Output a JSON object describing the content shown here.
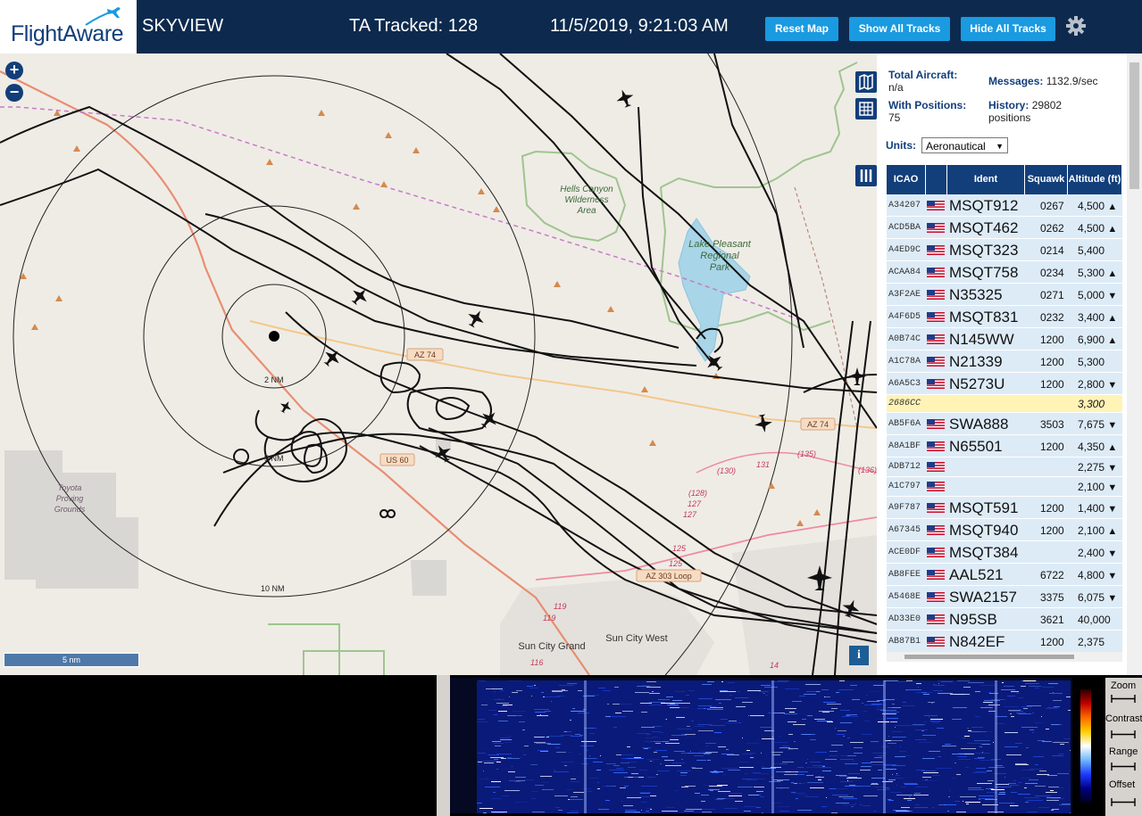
{
  "header": {
    "logo_text": "FlightAware",
    "site_name": "SKYVIEW",
    "tracked": "TA Tracked: 128",
    "datetime": "11/5/2019, 9:21:03 AM",
    "reset_map": "Reset Map",
    "show_tracks": "Show All Tracks",
    "hide_tracks": "Hide All Tracks",
    "settings_icon": "gear-icon"
  },
  "map": {
    "labels": {
      "hells_canyon": [
        "Hells Canyon",
        "Wilderness",
        "Area"
      ],
      "lake_pleasant": [
        "Lake Pleasant",
        "Regional",
        "Park"
      ],
      "toyota": [
        "Toyota",
        "Proving",
        "Grounds"
      ],
      "sun_city_grand": "Sun City Grand",
      "sun_city_west": "Sun City West",
      "az74_a": "AZ 74",
      "az74_b": "AZ 74",
      "us60": "US 60",
      "az303": "AZ 303 Loop",
      "ring_2": "2 NM",
      "ring_5": "5 NM",
      "ring_10": "10 NM",
      "r130": "(130)",
      "r135": "(135)",
      "r136": "(136)",
      "r131": "131",
      "r128": "(128)",
      "r127a": "127",
      "r127b": "127",
      "r125a": "125",
      "r125b": "125",
      "r119a": "119",
      "r119b": "119",
      "r116": "116",
      "r14": "14"
    },
    "scale": "5 nm",
    "zoom_in": "+",
    "zoom_out": "−",
    "info": "i"
  },
  "stats": {
    "total_label": "Total Aircraft:",
    "total_value": "n/a",
    "messages_label": "Messages:",
    "messages_value": "1132.9/sec",
    "positions_label": "With Positions:",
    "positions_value": "75",
    "history_label": "History:",
    "history_value": "29802",
    "history_unit": "positions",
    "units_label": "Units:",
    "units_value": "Aeronautical"
  },
  "table": {
    "headers": [
      "ICAO",
      "",
      "Ident",
      "Squawk",
      "Altitude (ft)"
    ],
    "rows": [
      {
        "icao": "A34207",
        "ident": "MSQT912",
        "squawk": "0267",
        "alt": "4,500",
        "trend": "▲"
      },
      {
        "icao": "ACD5BA",
        "ident": "MSQT462",
        "squawk": "0262",
        "alt": "4,500",
        "trend": "▲"
      },
      {
        "icao": "A4ED9C",
        "ident": "MSQT323",
        "squawk": "0214",
        "alt": "5,400",
        "trend": ""
      },
      {
        "icao": "ACAA84",
        "ident": "MSQT758",
        "squawk": "0234",
        "alt": "5,300",
        "trend": "▲"
      },
      {
        "icao": "A3F2AE",
        "ident": "N35325",
        "squawk": "0271",
        "alt": "5,000",
        "trend": "▼"
      },
      {
        "icao": "A4F6D5",
        "ident": "MSQT831",
        "squawk": "0232",
        "alt": "3,400",
        "trend": "▲"
      },
      {
        "icao": "A0B74C",
        "ident": "N145WW",
        "squawk": "1200",
        "alt": "6,900",
        "trend": "▲"
      },
      {
        "icao": "A1C78A",
        "ident": "N21339",
        "squawk": "1200",
        "alt": "5,300",
        "trend": ""
      },
      {
        "icao": "A6A5C3",
        "ident": "N5273U",
        "squawk": "1200",
        "alt": "2,800",
        "trend": "▼"
      },
      {
        "icao": "2686CC",
        "ident": "",
        "squawk": "",
        "alt": "3,300",
        "trend": ""
      },
      {
        "icao": "AB5F6A",
        "ident": "SWA888",
        "squawk": "3503",
        "alt": "7,675",
        "trend": "▼"
      },
      {
        "icao": "A8A1BF",
        "ident": "N65501",
        "squawk": "1200",
        "alt": "4,350",
        "trend": "▲"
      },
      {
        "icao": "ADB712",
        "ident": "",
        "squawk": "",
        "alt": "2,275",
        "trend": "▼"
      },
      {
        "icao": "A1C797",
        "ident": "",
        "squawk": "",
        "alt": "2,100",
        "trend": "▼"
      },
      {
        "icao": "A9F787",
        "ident": "MSQT591",
        "squawk": "1200",
        "alt": "1,400",
        "trend": "▼"
      },
      {
        "icao": "A67345",
        "ident": "MSQT940",
        "squawk": "1200",
        "alt": "2,100",
        "trend": "▲"
      },
      {
        "icao": "ACE0DF",
        "ident": "MSQT384",
        "squawk": "",
        "alt": "2,400",
        "trend": "▼"
      },
      {
        "icao": "AB8FEE",
        "ident": "AAL521",
        "squawk": "6722",
        "alt": "4,800",
        "trend": "▼"
      },
      {
        "icao": "A5468E",
        "ident": "SWA2157",
        "squawk": "3375",
        "alt": "6,075",
        "trend": "▼"
      },
      {
        "icao": "AD33E0",
        "ident": "N95SB",
        "squawk": "3621",
        "alt": "40,000",
        "trend": ""
      },
      {
        "icao": "AB87B1",
        "ident": "N842EF",
        "squawk": "1200",
        "alt": "2,375",
        "trend": ""
      }
    ]
  },
  "waterfall": {
    "zoom": "Zoom",
    "contrast": "Contrast",
    "range": "Range",
    "offset": "Offset"
  }
}
